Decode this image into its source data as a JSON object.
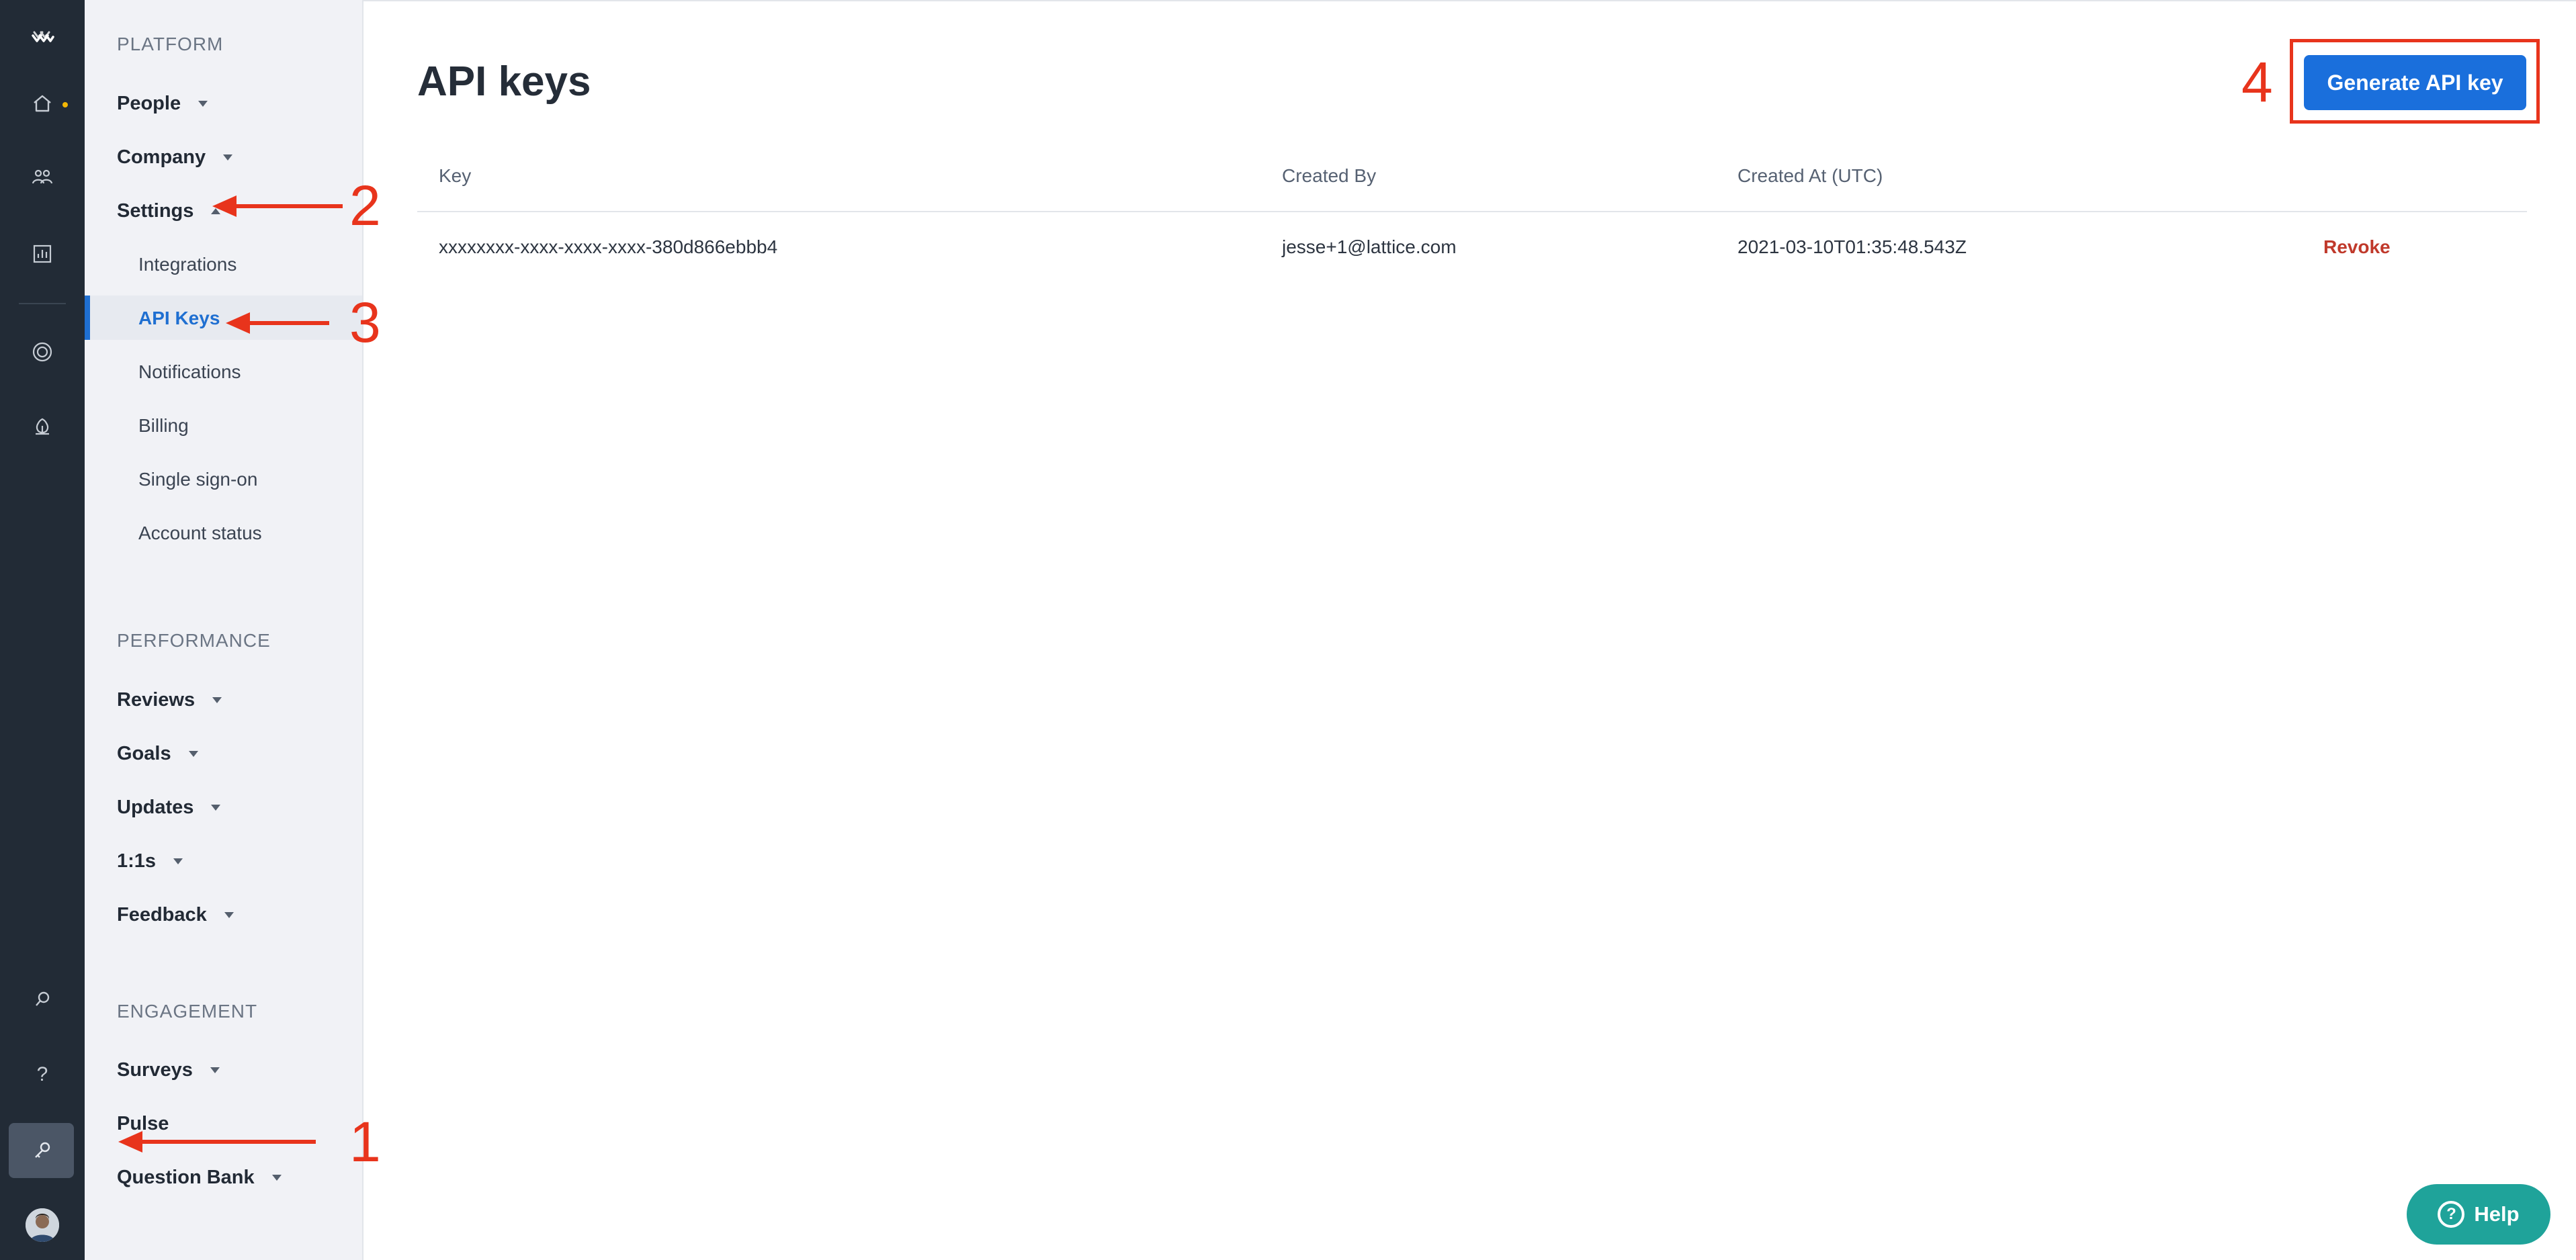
{
  "colors": {
    "rail_bg": "#222b36",
    "sidebar_bg": "#f1f2f6",
    "accent": "#1a6fdc",
    "danger": "#c0392b",
    "help": "#1fa39a",
    "annotation": "#e8341c",
    "notification_dot": "#f2b705"
  },
  "rail": {
    "icons": [
      "lattice-logo-icon",
      "home-icon",
      "people-icon",
      "analytics-icon",
      "goals-icon",
      "growth-icon",
      "search-icon",
      "question-icon",
      "admin-key-icon",
      "user-avatar"
    ],
    "help_glyph": "?"
  },
  "sidebar": {
    "platform": {
      "heading": "PLATFORM",
      "people": "People",
      "company": "Company",
      "settings": "Settings",
      "sub": {
        "integrations": "Integrations",
        "api_keys": "API Keys",
        "notifications": "Notifications",
        "billing": "Billing",
        "sso": "Single sign-on",
        "account_status": "Account status"
      }
    },
    "performance": {
      "heading": "PERFORMANCE",
      "reviews": "Reviews",
      "goals": "Goals",
      "updates": "Updates",
      "one_on_ones": "1:1s",
      "feedback": "Feedback"
    },
    "engagement": {
      "heading": "ENGAGEMENT",
      "surveys": "Surveys",
      "pulse": "Pulse",
      "question_bank": "Question Bank"
    }
  },
  "main": {
    "title": "API keys",
    "generate_button": "Generate API key",
    "table": {
      "headers": {
        "key": "Key",
        "created_by": "Created By",
        "created_at": "Created At (UTC)"
      },
      "rows": [
        {
          "key": "xxxxxxxx-xxxx-xxxx-xxxx-380d866ebbb4",
          "created_by": "jesse+1@lattice.com",
          "created_at": "2021-03-10T01:35:48.543Z",
          "action": "Revoke"
        }
      ]
    },
    "help_button": "Help",
    "help_glyph": "?"
  },
  "annotations": {
    "n1": "1",
    "n2": "2",
    "n3": "3",
    "n4": "4"
  }
}
